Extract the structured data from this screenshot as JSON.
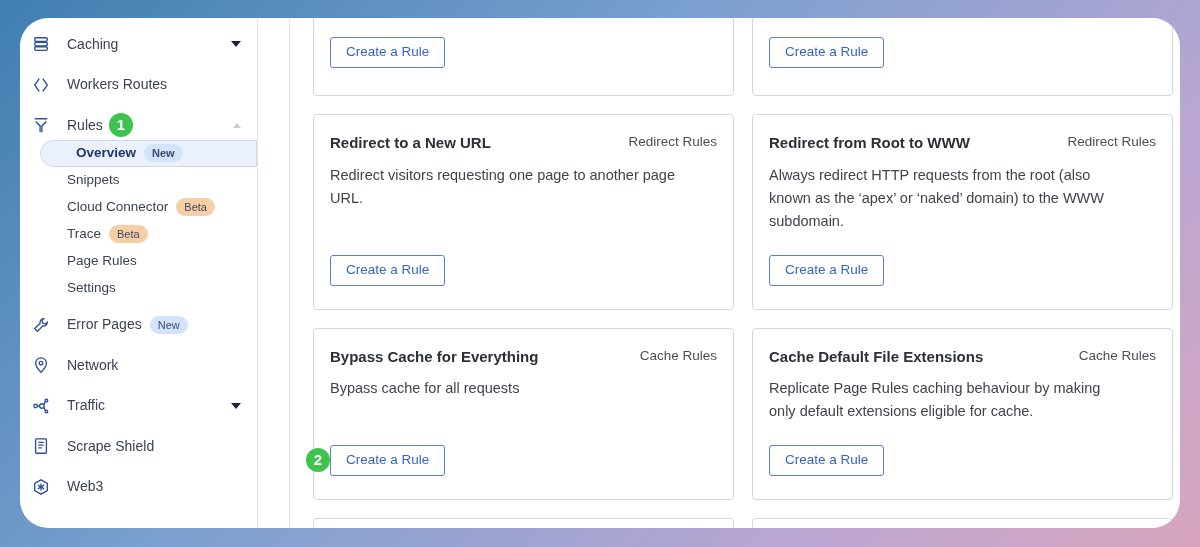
{
  "sidebar": {
    "items": [
      {
        "label": "Caching",
        "expanded": false
      },
      {
        "label": "Workers Routes"
      },
      {
        "label": "Rules",
        "marker": "1",
        "expanded": true,
        "children": [
          {
            "label": "Overview",
            "selected": true,
            "badge": {
              "label": "New",
              "color": "#d3e3fb"
            }
          },
          {
            "label": "Snippets",
            "selected": false
          },
          {
            "label": "Cloud Connector",
            "selected": false,
            "badge": {
              "label": "Beta",
              "color": "#f7cfa4"
            }
          },
          {
            "label": "Trace",
            "selected": false,
            "badge": {
              "label": "Beta",
              "color": "#f7cfa4"
            }
          },
          {
            "label": "Page Rules",
            "selected": false
          },
          {
            "label": "Settings",
            "selected": false
          }
        ]
      },
      {
        "label": "Error Pages",
        "badge": {
          "label": "New",
          "color": "#d3e3fb"
        }
      },
      {
        "label": "Network"
      },
      {
        "label": "Traffic",
        "expanded": false
      },
      {
        "label": "Scrape Shield"
      },
      {
        "label": "Web3"
      }
    ]
  },
  "cards": [
    {
      "kind": "cut_top",
      "button": "Create a Rule"
    },
    {
      "kind": "cut_top",
      "button": "Create a Rule"
    },
    {
      "kind": "full",
      "title": "Redirect to a New URL",
      "category": "Redirect Rules",
      "description": "Redirect visitors requesting one page to another page URL.",
      "button": "Create a Rule"
    },
    {
      "kind": "full",
      "title": "Redirect from Root to WWW",
      "category": "Redirect Rules",
      "description": "Always redirect HTTP requests from the root (also known as the ‘apex’ or ‘naked’ domain) to the WWW subdomain.",
      "button": "Create a Rule"
    },
    {
      "kind": "full",
      "title": "Bypass Cache for Everything",
      "category": "Cache Rules",
      "description": "Bypass cache for all requests",
      "button": "Create a Rule",
      "marker": "2"
    },
    {
      "kind": "full",
      "title": "Cache Default File Extensions",
      "category": "Cache Rules",
      "description": "Replicate Page Rules caching behaviour by making only default extensions eligible for cache.",
      "button": "Create a Rule"
    },
    {
      "kind": "cut_bottom"
    },
    {
      "kind": "cut_bottom"
    }
  ]
}
